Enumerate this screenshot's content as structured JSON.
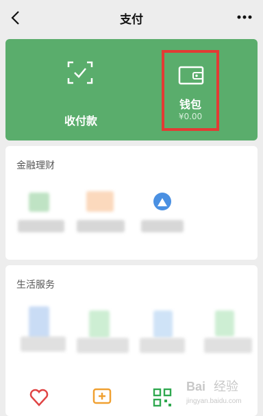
{
  "header": {
    "title": "支付"
  },
  "actions": {
    "pay": {
      "label": "收付款"
    },
    "wallet": {
      "label": "钱包",
      "balance": "¥0.00"
    }
  },
  "finance": {
    "title": "金融理财"
  },
  "life": {
    "title": "生活服务"
  },
  "colors": {
    "primary": "#5aad6c",
    "highlight": "#e23b34",
    "background": "#ededed"
  },
  "watermark": {
    "line1": "Bai 经验",
    "line2": "jingyan.baidu.com"
  }
}
